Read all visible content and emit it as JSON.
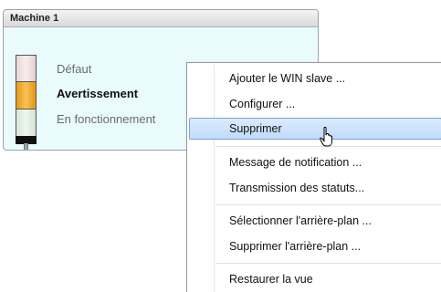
{
  "machine_panel": {
    "title": "Machine 1",
    "statuses": [
      {
        "label": "Défaut",
        "color": "#f2e6e6",
        "active": false
      },
      {
        "label": "Avertissement",
        "color": "#f5a623",
        "active": true
      },
      {
        "label": "En fonctionnement",
        "color": "#e5efe5",
        "active": false
      }
    ]
  },
  "context_menu": {
    "items": [
      {
        "label": "Ajouter le WIN slave ..."
      },
      {
        "label": "Configurer ..."
      },
      {
        "label": "Supprimer",
        "highlighted": true
      },
      {
        "label": "Message de notification ..."
      },
      {
        "label": "Transmission des statuts..."
      },
      {
        "label": "Sélectionner l'arrière-plan ..."
      },
      {
        "label": "Supprimer l'arrière-plan ..."
      },
      {
        "label": "Restaurer la vue"
      }
    ]
  },
  "cursor": {
    "icon": "hand-pointer-icon"
  }
}
